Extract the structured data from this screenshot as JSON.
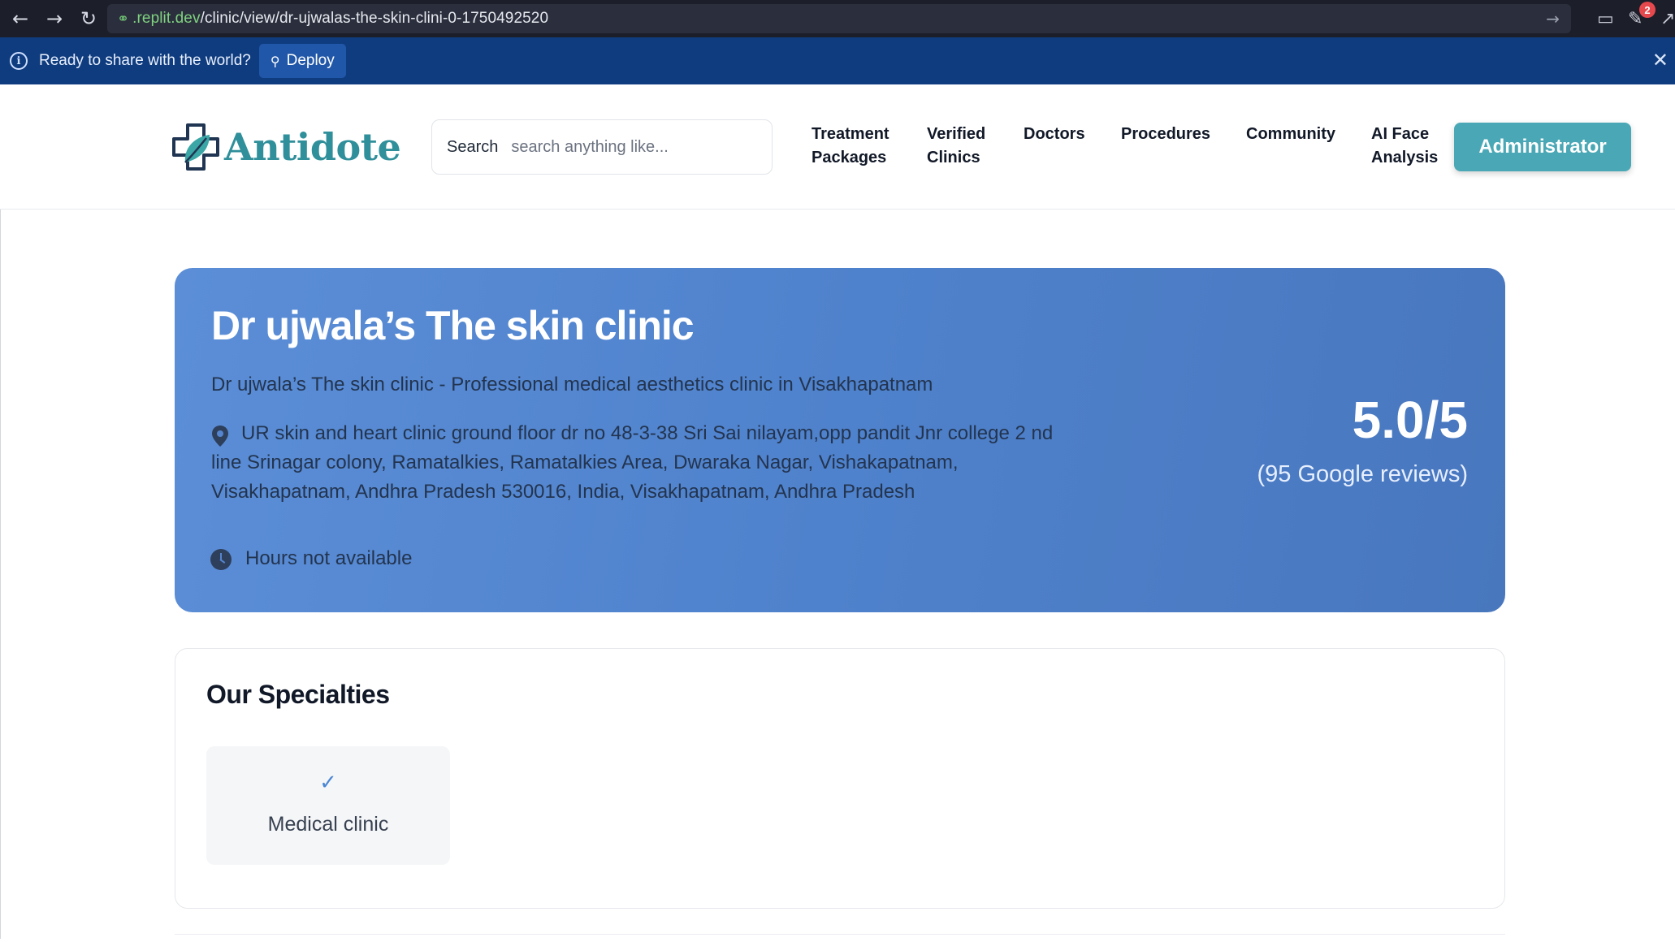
{
  "browser": {
    "url_domain": ".replit.dev",
    "url_path": "/clinic/view/dr-ujwalas-the-skin-clini-0-1750492520",
    "notification_count": "2"
  },
  "banner": {
    "message": "Ready to share with the world?",
    "deploy_label": "Deploy"
  },
  "header": {
    "logo_text": "Antidote",
    "search_label": "Search",
    "search_placeholder": "search anything like...",
    "nav": [
      {
        "line1": "Treatment",
        "line2": "Packages"
      },
      {
        "line1": "Verified",
        "line2": "Clinics"
      },
      {
        "line1": "Doctors",
        "line2": ""
      },
      {
        "line1": "Procedures",
        "line2": ""
      },
      {
        "line1": "Community",
        "line2": ""
      },
      {
        "line1": "AI Face",
        "line2": "Analysis"
      }
    ],
    "admin_label": "Administrator"
  },
  "clinic": {
    "name": "Dr ujwala’s The skin clinic",
    "description": "Dr ujwala’s The skin clinic - Professional medical aesthetics clinic in Visakhapatnam",
    "address": "UR skin and heart clinic ground floor dr no 48-3-38 Sri Sai nilayam,opp pandit Jnr college 2 nd line Srinagar colony, Ramatalkies, Ramatalkies Area, Dwaraka Nagar, Vishakapatnam, Visakhapatnam, Andhra Pradesh 530016, India, Visakhapatnam, Andhra Pradesh",
    "hours": "Hours not available",
    "rating": "5.0/5",
    "reviews": "(95 Google reviews)"
  },
  "specialties": {
    "title": "Our Specialties",
    "items": [
      {
        "label": "Medical clinic",
        "icon": "check-icon"
      }
    ]
  },
  "colors": {
    "hero_bg": "#5585cf",
    "brand_teal": "#2f8f9a",
    "admin_button": "#4aa8b6",
    "banner_bg": "#0f3c7f"
  }
}
